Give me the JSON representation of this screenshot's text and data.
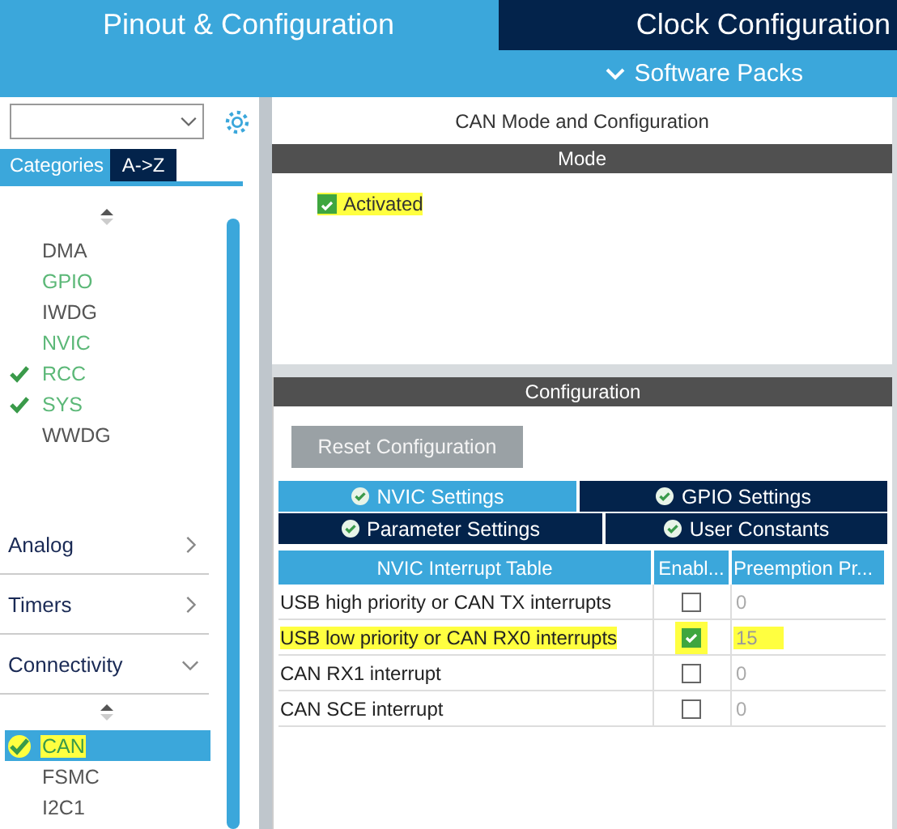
{
  "header": {
    "tabs": [
      {
        "label": "Pinout & Configuration",
        "selected": true
      },
      {
        "label": "Clock Configuration",
        "selected": false
      }
    ],
    "software_packs": "Software Packs"
  },
  "sidebar": {
    "view_tabs": [
      {
        "label": "Categories",
        "selected": true
      },
      {
        "label": "A->Z",
        "selected": false
      }
    ],
    "groups": [
      {
        "kind": "list",
        "items": [
          {
            "label": "DMA",
            "configured": false,
            "checked": false,
            "selected": false,
            "highlighted": false
          },
          {
            "label": "GPIO",
            "configured": true,
            "checked": false,
            "selected": false,
            "highlighted": false
          },
          {
            "label": "IWDG",
            "configured": false,
            "checked": false,
            "selected": false,
            "highlighted": false
          },
          {
            "label": "NVIC",
            "configured": true,
            "checked": false,
            "selected": false,
            "highlighted": false
          },
          {
            "label": "RCC",
            "configured": true,
            "checked": true,
            "selected": false,
            "highlighted": false
          },
          {
            "label": "SYS",
            "configured": true,
            "checked": true,
            "selected": false,
            "highlighted": false
          },
          {
            "label": "WWDG",
            "configured": false,
            "checked": false,
            "selected": false,
            "highlighted": false
          }
        ]
      },
      {
        "kind": "category",
        "label": "Analog",
        "expanded": false
      },
      {
        "kind": "category",
        "label": "Timers",
        "expanded": false
      },
      {
        "kind": "category",
        "label": "Connectivity",
        "expanded": true
      },
      {
        "kind": "list",
        "items": [
          {
            "label": "CAN",
            "configured": true,
            "checked": true,
            "selected": true,
            "highlighted": true
          },
          {
            "label": "FSMC",
            "configured": false,
            "checked": false,
            "selected": false,
            "highlighted": false
          },
          {
            "label": "I2C1",
            "configured": false,
            "checked": false,
            "selected": false,
            "highlighted": false
          }
        ]
      }
    ]
  },
  "panel": {
    "title": "CAN Mode and Configuration",
    "mode": {
      "heading": "Mode",
      "activated": {
        "label": "Activated",
        "checked": true,
        "highlighted": true
      }
    },
    "configuration": {
      "heading": "Configuration",
      "reset_button": "Reset Configuration",
      "tabs": [
        [
          {
            "label": "NVIC Settings",
            "selected": true
          },
          {
            "label": "GPIO Settings",
            "selected": false
          }
        ],
        [
          {
            "label": "Parameter Settings",
            "selected": false
          },
          {
            "label": "User Constants",
            "selected": false
          }
        ]
      ],
      "table": {
        "columns": [
          "NVIC Interrupt Table",
          "Enabl...",
          "Preemption Pr..."
        ],
        "rows": [
          {
            "name": "USB high priority or CAN TX interrupts",
            "enabled": false,
            "priority": "0",
            "highlighted": false
          },
          {
            "name": "USB low priority or CAN RX0 interrupts",
            "enabled": true,
            "priority": "15",
            "highlighted": true
          },
          {
            "name": "CAN RX1 interrupt",
            "enabled": false,
            "priority": "0",
            "highlighted": false
          },
          {
            "name": "CAN SCE interrupt",
            "enabled": false,
            "priority": "0",
            "highlighted": false
          }
        ]
      }
    }
  }
}
